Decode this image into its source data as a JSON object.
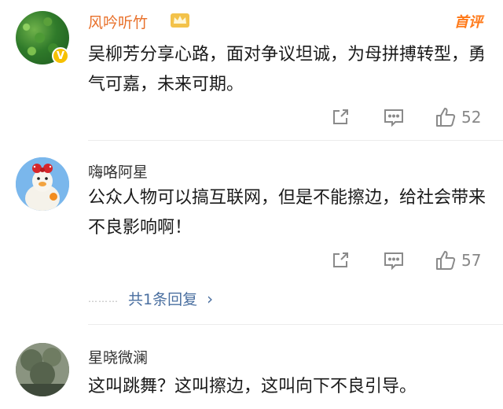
{
  "comments": [
    {
      "username": "风吟听竹",
      "verified_badge": "V",
      "tag": "首评",
      "text": "吴柳芳分享心路，面对争议坦诚，为母拼搏转型，勇气可嘉，未来可期。",
      "likes": "52",
      "icons": [
        "share-icon",
        "comment-icon",
        "like-icon"
      ]
    },
    {
      "username": "嗨咯阿星",
      "text": "公众人物可以搞互联网，但是不能擦边，给社会带来不良影响啊！",
      "likes": "57",
      "replies_dots": "………",
      "replies_label": "共1条回复",
      "replies_chevron": "›",
      "icons": [
        "share-icon",
        "comment-icon",
        "like-icon"
      ]
    },
    {
      "username": "星晓微澜",
      "text": "这叫跳舞？这叫擦边，这叫向下不良引导。"
    }
  ],
  "colors": {
    "username_highlight": "#e8702a",
    "hot_tag": "#ff7a1a",
    "link": "#4a6fa0",
    "muted": "#888888"
  }
}
